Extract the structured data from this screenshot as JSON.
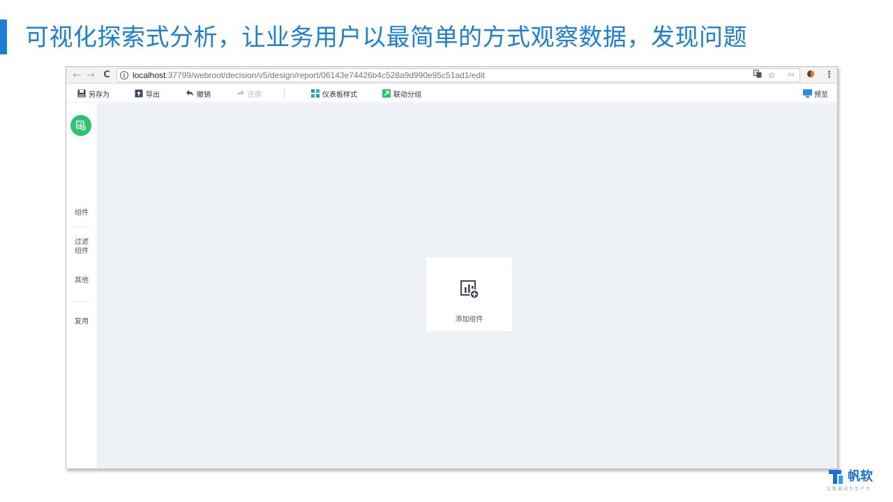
{
  "slide": {
    "title": "可视化探索式分析，让业务用户以最简单的方式观察数据，发现问题",
    "accent_color": "#1b7fd6"
  },
  "browser": {
    "url_host": "localhost",
    "url_path": ":37799/webroot/decision/v5/design/report/06143e74426b4c528a9d990e95c51ad1/edit",
    "nav_icons": [
      "back-arrow-icon",
      "forward-arrow-icon",
      "refresh-icon",
      "info-icon",
      "translate-icon",
      "star-icon",
      "extension-icon",
      "menu-icon"
    ]
  },
  "toolbar": {
    "save_as": "另存为",
    "export": "导出",
    "undo": "撤销",
    "redo": "还原",
    "dashboard_style": "仪表板样式",
    "linkage_group": "联动分组",
    "preview": "预览"
  },
  "sidebar": {
    "components": "组件",
    "filter_line1": "过滤",
    "filter_line2": "组件",
    "other": "其他",
    "reuse": "复用",
    "active_color": "#2cc56f"
  },
  "canvas": {
    "add_component": "添加组件",
    "background": "#edf1f5"
  },
  "logo": {
    "name": "帆软",
    "slogan": "让数据成为生产力"
  }
}
